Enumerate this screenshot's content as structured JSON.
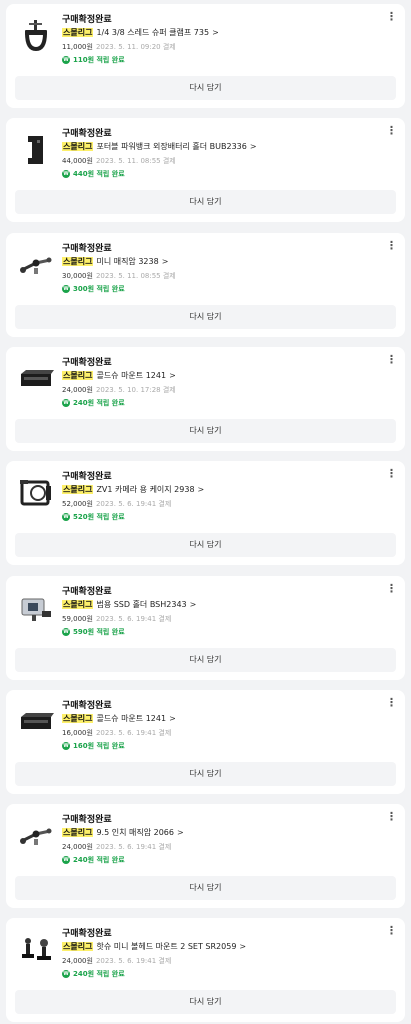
{
  "orders": [
    {
      "status": "구매확정완료",
      "brand": "스몰리그",
      "product": "1/4 3/8 스레드 슈퍼 클램프 735",
      "price": "11,000원",
      "date": "2023. 5. 11. 09:20 결제",
      "points": "110원 적립 완료",
      "button": "다시 담기",
      "more": "⋮",
      "icon": "clamp-icon"
    },
    {
      "status": "구매확정완료",
      "brand": "스몰리그",
      "product": "포터블 파워뱅크 외장배터리 홀더 BUB2336",
      "price": "44,000원",
      "date": "2023. 5. 11. 08:55 결제",
      "points": "440원 적립 완료",
      "button": "다시 담기",
      "more": "⋮",
      "icon": "battery-holder-icon"
    },
    {
      "status": "구매확정완료",
      "brand": "스몰리그",
      "product": "미니 매직암 3238",
      "price": "30,000원",
      "date": "2023. 5. 11. 08:55 결제",
      "points": "300원 적립 완료",
      "button": "다시 담기",
      "more": "⋮",
      "icon": "magic-arm-icon"
    },
    {
      "status": "구매확정완료",
      "brand": "스몰리그",
      "product": "콜드슈 마운트 1241",
      "price": "24,000원",
      "date": "2023. 5. 10. 17:28 결제",
      "points": "240원 적립 완료",
      "button": "다시 담기",
      "more": "⋮",
      "icon": "cold-shoe-icon"
    },
    {
      "status": "구매확정완료",
      "brand": "스몰리그",
      "product": "ZV1 카메라 용 케이지 2938",
      "price": "52,000원",
      "date": "2023. 5. 6. 19:41 결제",
      "points": "520원 적립 완료",
      "button": "다시 담기",
      "more": "⋮",
      "icon": "camera-cage-icon"
    },
    {
      "status": "구매확정완료",
      "brand": "스몰리그",
      "product": "범용 SSD 홀더 BSH2343",
      "price": "59,000원",
      "date": "2023. 5. 6. 19:41 결제",
      "points": "590원 적립 완료",
      "button": "다시 담기",
      "more": "⋮",
      "icon": "ssd-holder-icon"
    },
    {
      "status": "구매확정완료",
      "brand": "스몰리그",
      "product": "콜드슈 마운트 1241",
      "price": "16,000원",
      "date": "2023. 5. 6. 19:41 결제",
      "points": "160원 적립 완료",
      "button": "다시 담기",
      "more": "⋮",
      "icon": "cold-shoe-icon"
    },
    {
      "status": "구매확정완료",
      "brand": "스몰리그",
      "product": "9.5 인치 매직암 2066",
      "price": "24,000원",
      "date": "2023. 5. 6. 19:41 결제",
      "points": "240원 적립 완료",
      "button": "다시 담기",
      "more": "⋮",
      "icon": "magic-arm-icon"
    },
    {
      "status": "구매확정완료",
      "brand": "스몰리그",
      "product": "핫슈 미니 볼헤드 마운트 2 SET SR2059",
      "price": "24,000원",
      "date": "2023. 5. 6. 19:41 결제",
      "points": "240원 적립 완료",
      "button": "다시 담기",
      "more": "⋮",
      "icon": "ball-head-icon"
    }
  ],
  "point_badge": "W",
  "chevron": ">"
}
